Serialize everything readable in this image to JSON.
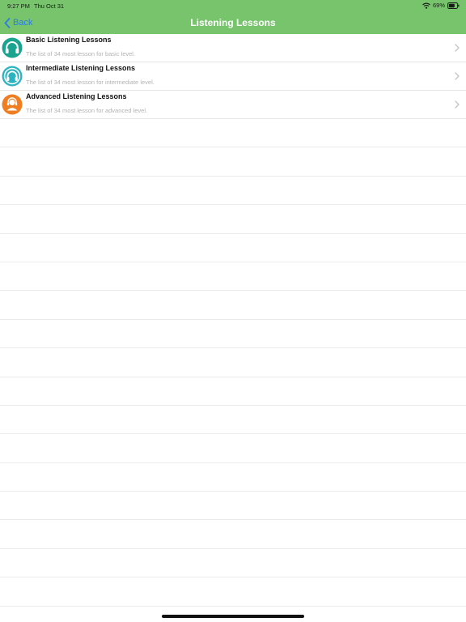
{
  "status_bar": {
    "time": "9:27 PM",
    "date": "Thu Oct 31",
    "battery": "69%",
    "icons": [
      "wifi-icon",
      "battery-icon"
    ]
  },
  "nav": {
    "back_label": "Back",
    "title": "Listening Lessons",
    "bar_color": "#77c46c",
    "back_color": "#2a7de1"
  },
  "lessons": [
    {
      "title": "Basic Listening Lessons",
      "subtitle": "The list of 34 most lesson for basic level.",
      "icon": "headphones-icon",
      "icon_color": "#1aa38f"
    },
    {
      "title": "Intermediate Listening Lessons",
      "subtitle": "The list of 34 most lesson for intermediate level.",
      "icon": "headphones-icon",
      "icon_color": "#2bb3c0"
    },
    {
      "title": "Advanced Listening Lessons",
      "subtitle": "The list of 34 most lesson for advanced level.",
      "icon": "headset-user-icon",
      "icon_color": "#ef7d22"
    }
  ]
}
